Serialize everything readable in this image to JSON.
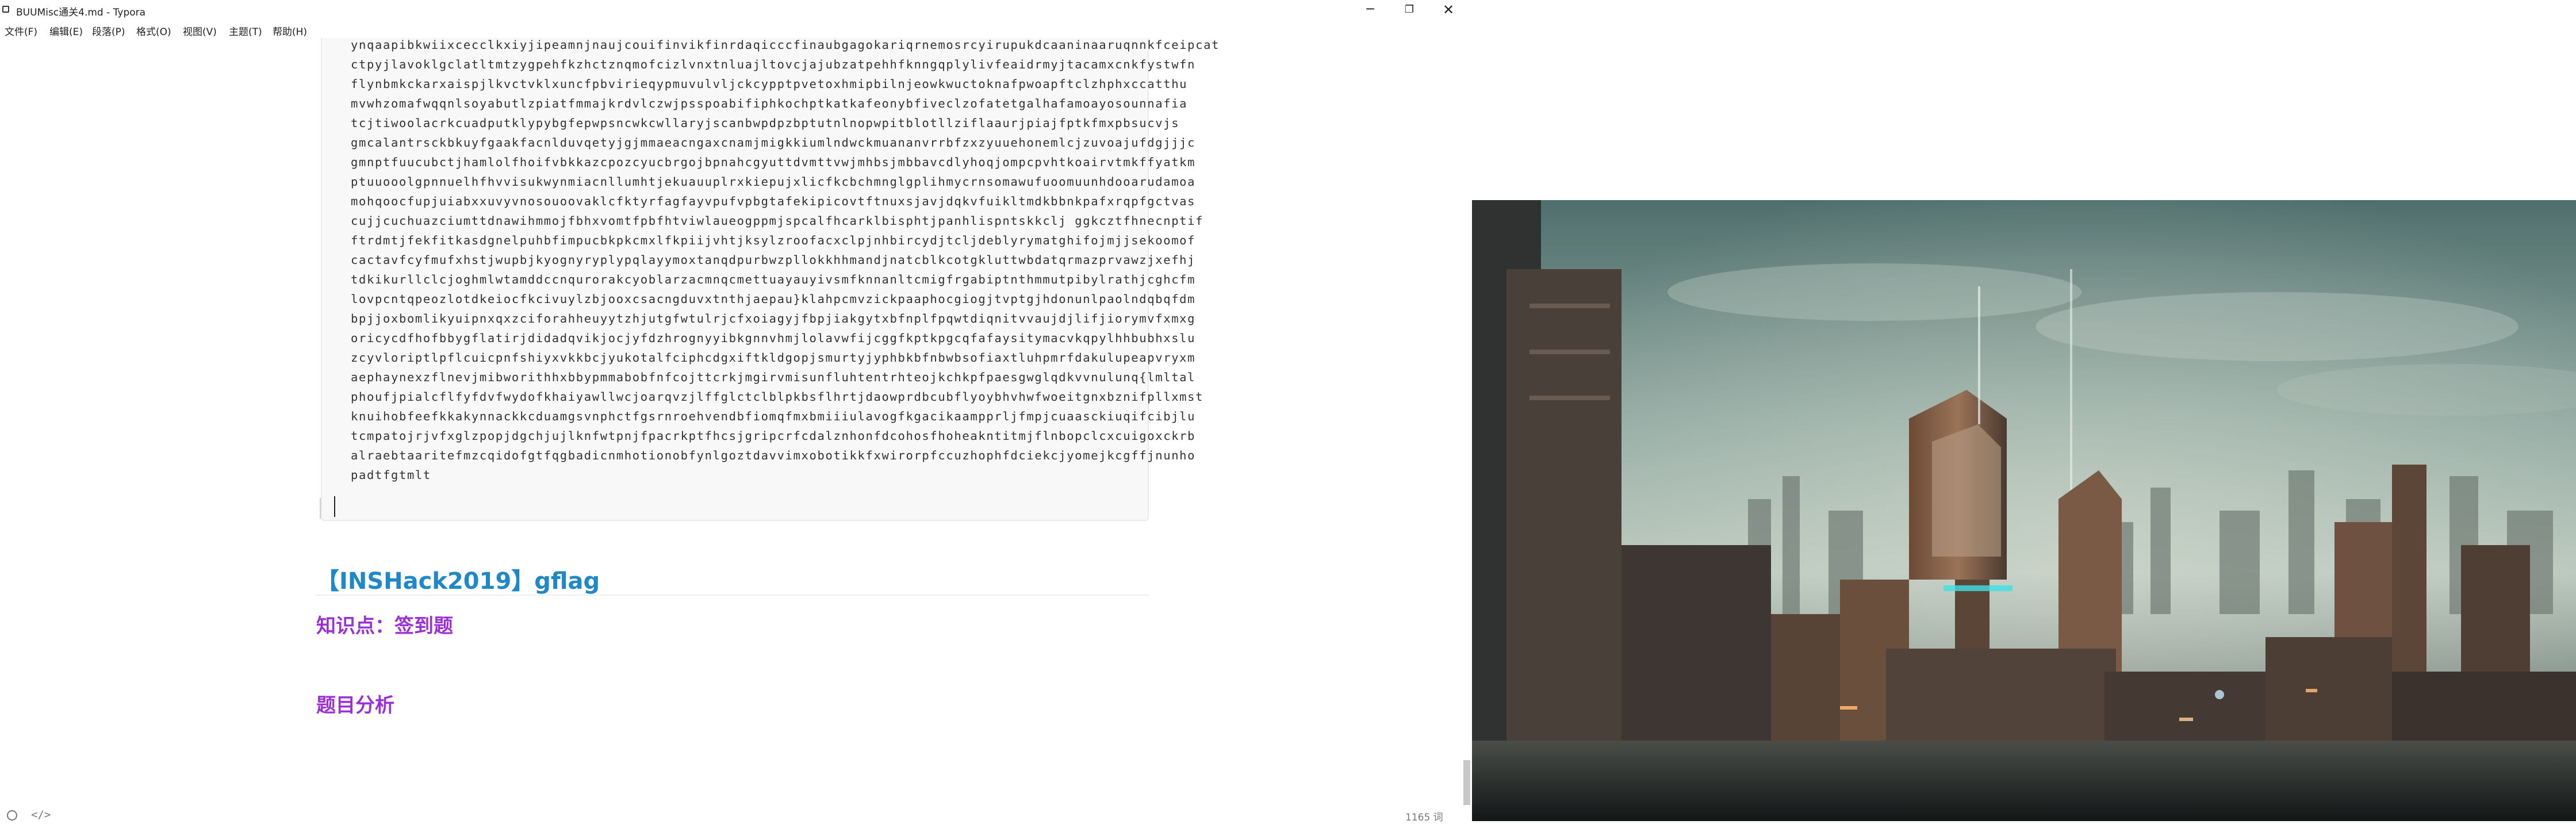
{
  "window": {
    "title": "BUUMisc通关4.md - Typora",
    "controls": {
      "minimize": "─",
      "maximize": "❐",
      "close": "✕"
    }
  },
  "menu": [
    "文件(F)",
    "编辑(E)",
    "段落(P)",
    "格式(O)",
    "视图(V)",
    "主题(T)",
    "帮助(H)"
  ],
  "code_lines": [
    "ynqaapibkwiixcecclkxiyjipeamnjnaujcouifinvikfinrdaqicccfinaubgagokariqrnemosrcyirupukdcaaninaaruqnnkfceipcat",
    "ctpyjlavoklgclatltmtzygpehfkzhctznqmofcizlvnxtnluajltovcjajubzatpehhfknngqplylivfeaidrmyjtacamxcnkfystwfn",
    "flynbmkckarxaispjlkvctvklxuncfpbvirieqypmuvulvljckcypptpvetoxhmipbilnjeowkwuctoknafpwoapftclzhphxccatthu",
    "mvwhzomafwqqnlsoyabutlzpiatfmmajkrdvlczwjpsspoabifiphkochptkatkafeonybfiveclzofatetgalhafamoayosounnafia",
    "tcjtiwoolacrkcuadputklypybgfepwpsncwkcwllaryjscanbwpdpzbptutnlnopwpitblotllziflaaurjpiajfptkfmxpbsucvjs",
    "gmcalantrsckbkuyfgaakfacnlduvqetyjgjmmaeacngaxcnamjmigkkiumlndwckmuananvrrbfzxzyuuehonemlcjzuvoajufdgjjjc",
    "gmnptfuucubctjhamlolfhoifvbkkazcpozcyucbrgojbpnahcgyuttdvmttvwjmhbsjmbbavcdlyhoqjompcpvhtkoairvtmkffyatkm",
    "ptuuooolgpnnuelhfhvvisukwynmiacnllumhtjekuauuplrxkiepujxlicfkcbchmnglgplihmycrnsomawufuoomuunhdooarudamoa",
    "mohqoocfupjuiabxxuvyvnosouoovaklcfktyrfagfayvpufvpbgtafekipicovtftnuxsjavjdqkvfuikltmdkbbnkpafxrqpfgctvas",
    "cujjcuchuazciumttdnawihmmojfbhxvomtfpbfhtviwlaueogppmjspcalfhcarklbisphtjpanhlispntskkclj ggkcztfhnecnptif",
    "ftrdmtjfekfitkasdgnelpuhbfimpucbkpkcmxlfkpiijvhtjksylzroofacxclpjnhbircydjtcljdeblyrymatghifojmjjsekoomof",
    "cactavfcyfmufxhstjwupbjkyognyryplypqlayymoxtanqdpurbwzpllokkhhmandjnatcblkcotgkluttwbdatqrmazprvawzjxefhj",
    "tdkikurllclcjoghmlwtamddccnqurorakcyoblarzacmnqcmettuayauyivsmfknnanltcmigfrgabiptnthmmutpibylrathjcghcfm",
    "lovpcntqpeozlotdkeiocfkcivuylzbjooxcsacngduvxtnthjaepau}klahpcmvzickpaaphocgiogjtvptgjhdonunlpaolndqbqfdm",
    "bpjjoxbomlikyuipnxqxzciforahheuyytzhjutgfwtulrjcfxoiagyjfbpjiakgytxbfnplfpqwtdiqnitvvaujdjlifjiorymvfxmxg",
    "oricycdfhofbbygflatirjdidadqvikjocjyfdzhrognyyibkgnnvhmjlolavwfijcggfkptkpgcqfafaysitymacvkqpylhhbubhxslu",
    "zcyvloriptlpflcuicpnfshiyxvkkbcjyukotalfciphcdgxiftkldgopjsmurtyjyphbkbfnbwbsofiaxtluhpmrfdakulupeapvryxm",
    "aephaynexzflnevjmibworithhxbbypmmabobfnfcojttcrkjmgirvmisunfluhtentrhteojkchkpfpaesgwglqdkvvnulunq{lmltal",
    "phoufjpialcflfyfdvfwydofkhaiyawllwcjoarqvzjlffglctclblpkbsflhrtjdaowprdbcubflyoybhvhwfwoeitgnxbznifpllxmst",
    "knuihobfeefkkakynnackkcduamgsvnphctfgsrnroehvendbfiomqfmxbmiiiulavogfkgacikaampprljfmpjcuaasckiuqifcibjlu",
    "tcmpatojrjvfxglzpopjdgchjujlknfwtpnjfpacrkptfhcsjgripcrfcdalznhonfdcohosfhoheakntitmjflnbopclcxcuigoxckrb",
    "alraebtaaritefmzcqidofgtfqgbadicnmhotionobfynlgoztdavvimxobotikkfxwirorpfccuzhophfdciekcjyomejkcgffjnunho",
    "padtfgtmlt"
  ],
  "headings": {
    "h2": "【INSHack2019】gflag",
    "knowledge": "知识点：签到题",
    "analysis": "题目分析"
  },
  "status": {
    "source_toggle": "</>",
    "word_count": "1165 词"
  },
  "colors": {
    "heading_blue": "#1e88c9",
    "heading_purple": "#9b30d9"
  }
}
